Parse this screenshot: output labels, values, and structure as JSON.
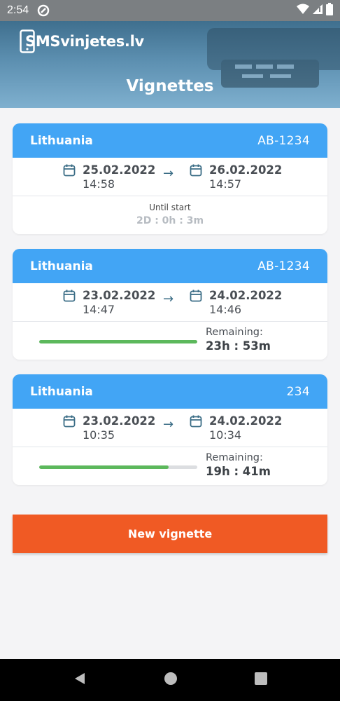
{
  "status_bar": {
    "time": "2:54"
  },
  "header": {
    "logo": "SMSvinjetes.lv",
    "title": "Vignettes"
  },
  "vignettes": [
    {
      "country": "Lithuania",
      "plate": "AB-1234",
      "from_date": "25.02.2022",
      "from_time": "14:58",
      "to_date": "26.02.2022",
      "to_time": "14:57",
      "status_label": "Until start",
      "status_value": "2D : 0h : 3m"
    },
    {
      "country": "Lithuania",
      "plate": "AB-1234",
      "from_date": "23.02.2022",
      "from_time": "14:47",
      "to_date": "24.02.2022",
      "to_time": "14:46",
      "status_label": "Remaining:",
      "status_value": "23h : 53m",
      "progress": 1.0
    },
    {
      "country": "Lithuania",
      "plate": "234",
      "from_date": "23.02.2022",
      "from_time": "10:35",
      "to_date": "24.02.2022",
      "to_time": "10:34",
      "status_label": "Remaining:",
      "status_value": "19h : 41m",
      "progress": 0.82
    }
  ],
  "actions": {
    "new_vignette": "New vignette"
  },
  "colors": {
    "header_blue": "#42a5f5",
    "accent_orange": "#f05a24",
    "progress_green": "#5cb85c",
    "arrow": "#3b6d86"
  },
  "icons": {
    "date": "calendar-icon",
    "arrow": "arrow-right-icon"
  }
}
